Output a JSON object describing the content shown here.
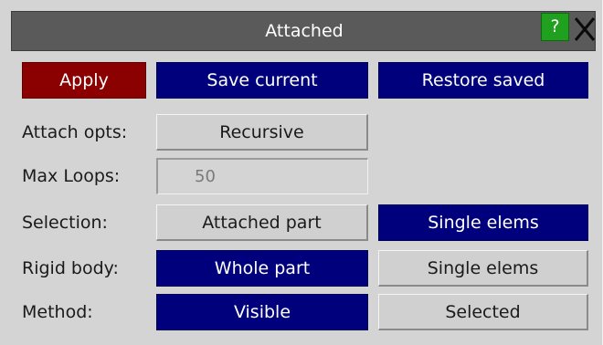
{
  "window": {
    "title": "Attached",
    "help_label": "?"
  },
  "toolbar": {
    "apply_label": "Apply",
    "save_label": "Save current",
    "restore_label": "Restore saved"
  },
  "attach_opts": {
    "label": "Attach opts:",
    "value": "Recursive"
  },
  "max_loops": {
    "label": "Max Loops:",
    "value": "50"
  },
  "selection": {
    "label": "Selection:",
    "options": [
      "Attached part",
      "Single elems"
    ],
    "selected": "Single elems"
  },
  "rigid_body": {
    "label": "Rigid body:",
    "options": [
      "Whole part",
      "Single elems"
    ],
    "selected": "Whole part"
  },
  "method": {
    "label": "Method:",
    "options": [
      "Visible",
      "Selected"
    ],
    "selected": "Visible"
  },
  "colors": {
    "panel_bg": "#d4d4d4",
    "titlebar_bg": "#5a5a5a",
    "apply_red": "#8b0000",
    "active_blue": "#00007d",
    "help_green": "#1fa01f"
  },
  "icons": {
    "help": "question-mark-icon",
    "close": "close-x-icon"
  }
}
